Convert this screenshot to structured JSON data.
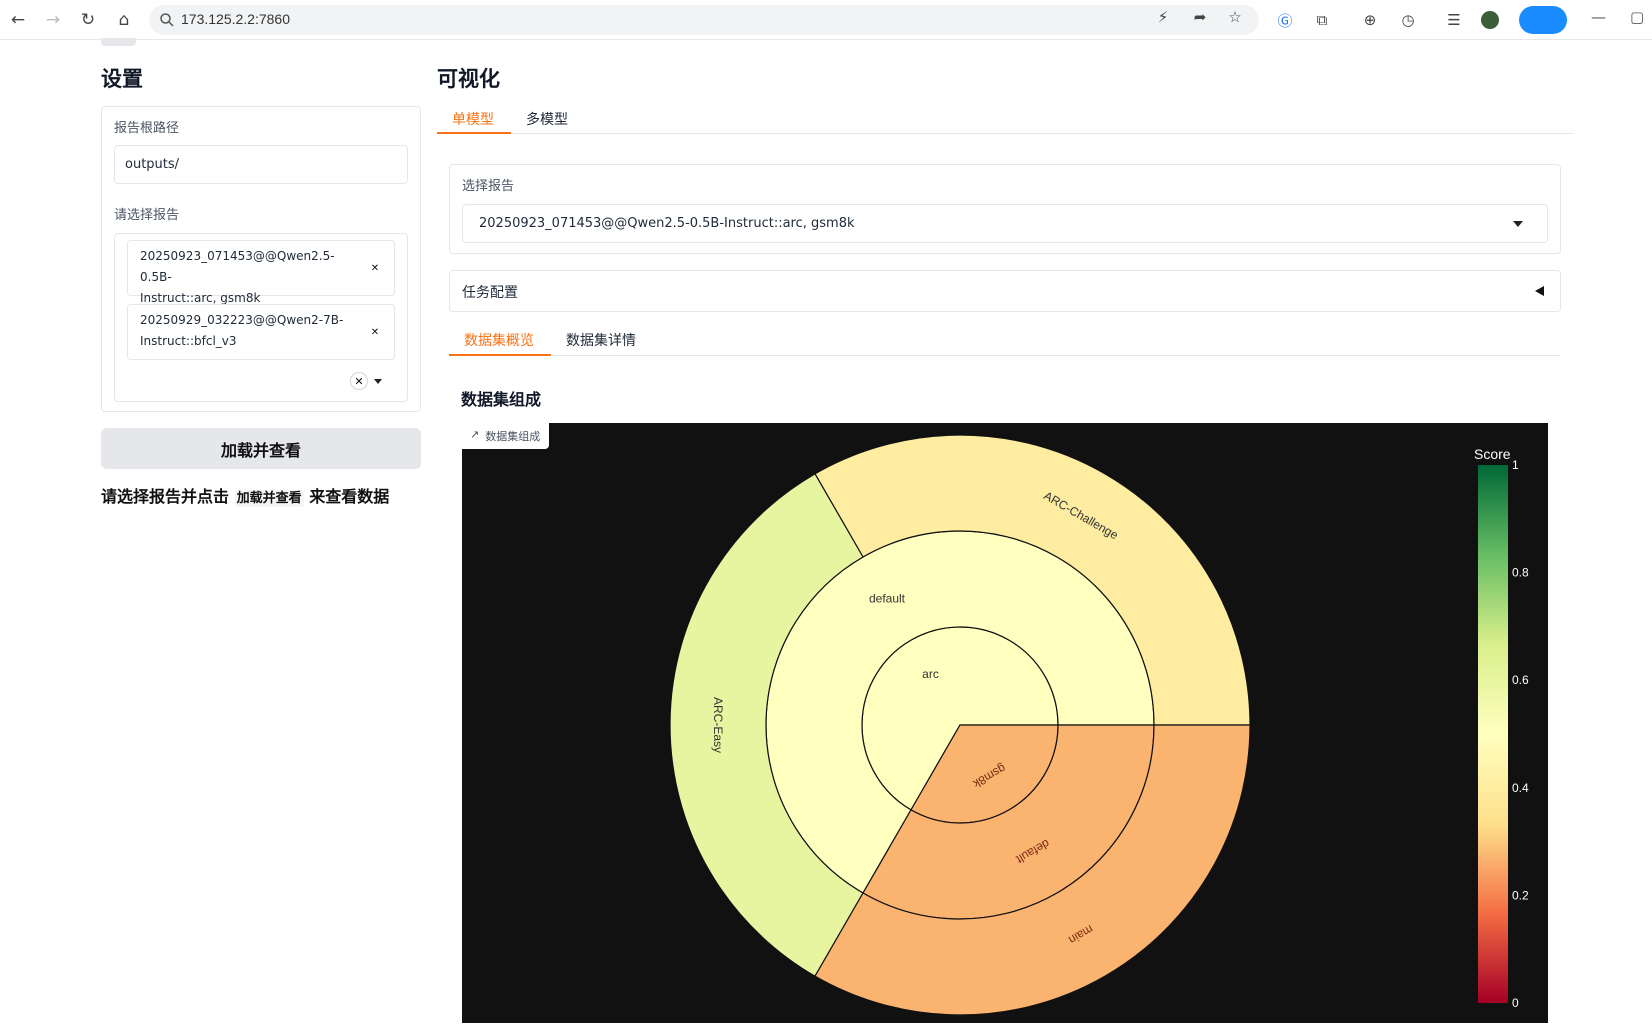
{
  "browser": {
    "url": "173.125.2.2:7860"
  },
  "settings": {
    "title": "设置",
    "root_path_label": "报告根路径",
    "root_path_value": "outputs/",
    "select_reports_label": "请选择报告",
    "selected_reports": [
      {
        "line1": "20250923_071453@@Qwen2.5-0.5B-",
        "line2": "Instruct::arc, gsm8k"
      },
      {
        "line1": "20250929_032223@@Qwen2-7B-",
        "line2": "Instruct::bfcl_v3"
      }
    ],
    "load_button": "加载并查看",
    "hint_prefix": "请选择报告并点击",
    "hint_code": "加载并查看",
    "hint_suffix": "来查看数据"
  },
  "visualization": {
    "title": "可视化",
    "tabs": [
      "单模型",
      "多模型"
    ],
    "active_tab": "单模型",
    "select_report_label": "选择报告",
    "select_report_value": "20250923_071453@@Qwen2.5-0.5B-Instruct::arc, gsm8k",
    "task_config_label": "任务配置",
    "subtabs": [
      "数据集概览",
      "数据集详情"
    ],
    "active_subtab": "数据集概览",
    "plot_title": "数据集组成",
    "plot_badge": "数据集组成"
  },
  "chart_data": {
    "type": "sunburst",
    "colorbar_title": "Score",
    "colorbar_ticks": [
      "0",
      "0.2",
      "0.4",
      "0.6",
      "0.8",
      "1"
    ],
    "colorscale": [
      "#a50026",
      "#f46d43",
      "#fee08b",
      "#ffffbf",
      "#d9ef8b",
      "#66bd63",
      "#006837"
    ],
    "nodes": [
      {
        "label": "arc",
        "ring": 1,
        "start_deg": 0,
        "end_deg": 240,
        "score": 0.5
      },
      {
        "label": "gsm8k",
        "ring": 1,
        "start_deg": 240,
        "end_deg": 360,
        "score": 0.27
      },
      {
        "label": "default",
        "ring": 2,
        "start_deg": 0,
        "end_deg": 240,
        "score": 0.5
      },
      {
        "label": "default",
        "ring": 2,
        "start_deg": 240,
        "end_deg": 360,
        "score": 0.27
      },
      {
        "label": "ARC-Challenge",
        "ring": 3,
        "start_deg": 0,
        "end_deg": 120,
        "score": 0.4
      },
      {
        "label": "ARC-Easy",
        "ring": 3,
        "start_deg": 120,
        "end_deg": 240,
        "score": 0.6
      },
      {
        "label": "main",
        "ring": 3,
        "start_deg": 240,
        "end_deg": 360,
        "score": 0.27
      }
    ]
  }
}
